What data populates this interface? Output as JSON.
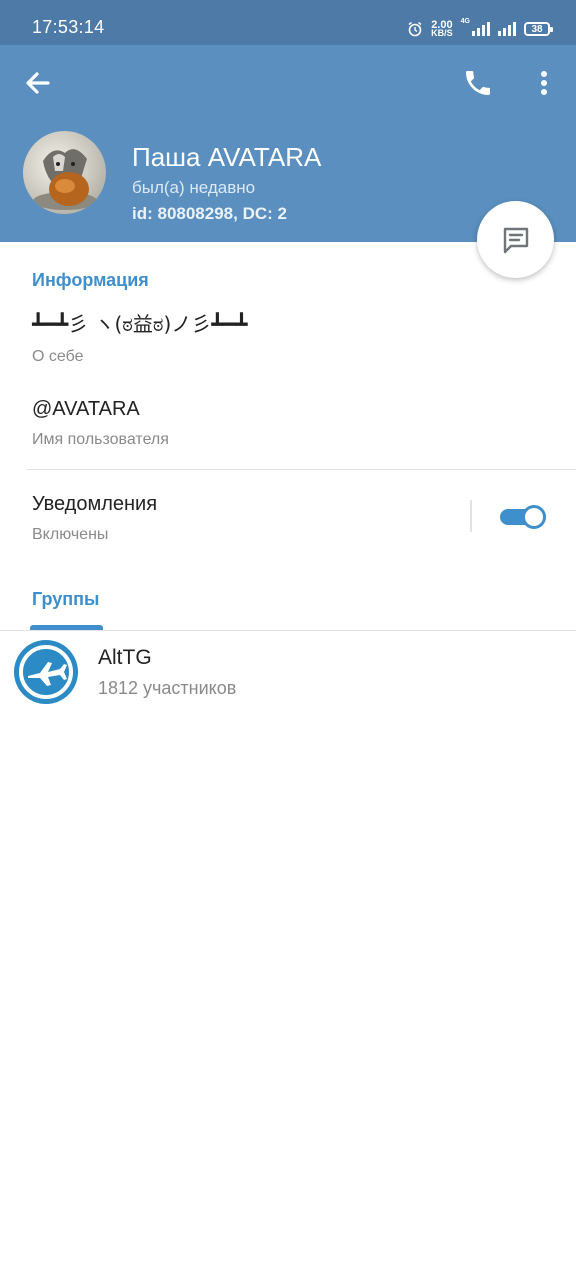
{
  "status_bar": {
    "time": "17:53:14",
    "speed_value": "2.00",
    "speed_unit": "KB/S",
    "network_tag": "4G",
    "battery": "38",
    "icons": [
      "alarm-icon",
      "signal-icon",
      "signal-icon",
      "battery-icon"
    ]
  },
  "header": {
    "name": "Паша AVATARA",
    "last_seen": "был(а) недавно",
    "user_id": "id: 80808298, DC: 2",
    "background_color": "#5a8fbf",
    "icons": [
      "back-arrow-icon",
      "phone-icon",
      "more-vertical-icon",
      "message-icon"
    ]
  },
  "info": {
    "section_title": "Информация",
    "bio": "┻━┻彡 ヽ(ಠ益ಠ)ノ彡┻━┻",
    "bio_label": "О себе",
    "username": "@AVATARA",
    "username_label": "Имя пользователя"
  },
  "notifications": {
    "title": "Уведомления",
    "state": "Включены",
    "enabled": true
  },
  "groups": {
    "tab_label": "Группы",
    "accent_color": "#3f8fcc",
    "items": [
      {
        "name": "AltTG",
        "members": "1812 участников"
      }
    ]
  }
}
